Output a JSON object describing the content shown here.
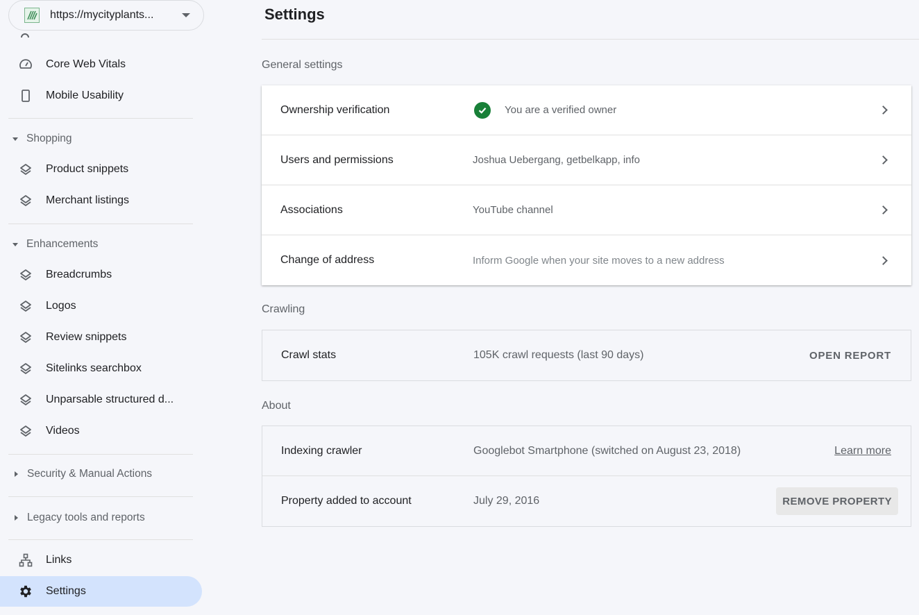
{
  "property": {
    "url": "https://mycityplants..."
  },
  "sidebar": {
    "experience": [
      {
        "label": "Core Web Vitals",
        "icon": "speedometer-icon"
      },
      {
        "label": "Mobile Usability",
        "icon": "smartphone-icon"
      }
    ],
    "shopping": {
      "header": "Shopping",
      "items": [
        {
          "label": "Product snippets",
          "icon": "layers-icon"
        },
        {
          "label": "Merchant listings",
          "icon": "layers-icon"
        }
      ]
    },
    "enhancements": {
      "header": "Enhancements",
      "items": [
        {
          "label": "Breadcrumbs",
          "icon": "layers-icon"
        },
        {
          "label": "Logos",
          "icon": "layers-icon"
        },
        {
          "label": "Review snippets",
          "icon": "layers-icon"
        },
        {
          "label": "Sitelinks searchbox",
          "icon": "layers-icon"
        },
        {
          "label": "Unparsable structured d...",
          "icon": "layers-icon"
        },
        {
          "label": "Videos",
          "icon": "layers-icon"
        }
      ]
    },
    "security": {
      "header": "Security & Manual Actions"
    },
    "legacy": {
      "header": "Legacy tools and reports"
    },
    "links": {
      "label": "Links",
      "icon": "sitemap-icon"
    },
    "settings": {
      "label": "Settings",
      "icon": "gear-icon"
    }
  },
  "main": {
    "title": "Settings",
    "general": {
      "label": "General settings",
      "rows": [
        {
          "label": "Ownership verification",
          "value": "You are a verified owner"
        },
        {
          "label": "Users and permissions",
          "value": "Joshua Uebergang, getbelkapp, info"
        },
        {
          "label": "Associations",
          "value": "YouTube channel"
        },
        {
          "label": "Change of address",
          "value": "Inform Google when your site moves to a new address"
        }
      ]
    },
    "crawling": {
      "label": "Crawling",
      "row": {
        "label": "Crawl stats",
        "value": "105K crawl requests (last 90 days)",
        "action": "OPEN REPORT"
      }
    },
    "about": {
      "label": "About",
      "rows": [
        {
          "label": "Indexing crawler",
          "value": "Googlebot Smartphone (switched on August 23, 2018)",
          "action": "Learn more"
        },
        {
          "label": "Property added to account",
          "value": "July 29, 2016",
          "action": "REMOVE PROPERTY"
        }
      ]
    }
  },
  "colors": {
    "accent_active": "#d3e3fd",
    "verified_green": "#188038"
  }
}
